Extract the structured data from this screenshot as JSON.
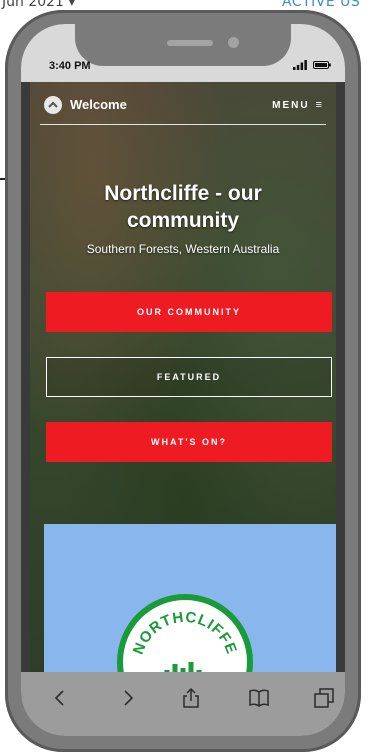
{
  "background_page": {
    "date_text": "Jun 2021 ▾",
    "active_text": "ACTIVE US"
  },
  "status_bar": {
    "time": "3:40 PM",
    "signal_icon": "signal-icon",
    "battery_icon": "battery-icon"
  },
  "nav": {
    "logo_icon": "chevron-up-icon",
    "title": "Welcome",
    "menu_label": "MENU",
    "menu_icon": "hamburger-icon"
  },
  "hero": {
    "title_line1": "Northcliffe - our",
    "title_line2": "community",
    "subtitle": "Southern Forests, Western Australia"
  },
  "buttons": [
    {
      "label": "OUR COMMUNITY",
      "style": "filled",
      "color": "#ef1b23"
    },
    {
      "label": "FEATURED",
      "style": "outline"
    },
    {
      "label": "WHAT'S ON?",
      "style": "filled",
      "color": "#ef1b23"
    }
  ],
  "card": {
    "logo_text": "NORTHCLIFFE",
    "background": "#8ab6ee",
    "logo_ring_color": "#1a9b3a"
  },
  "toolbar": {
    "icons": [
      "back-icon",
      "forward-icon",
      "share-icon",
      "bookmarks-icon",
      "tabs-icon"
    ]
  }
}
